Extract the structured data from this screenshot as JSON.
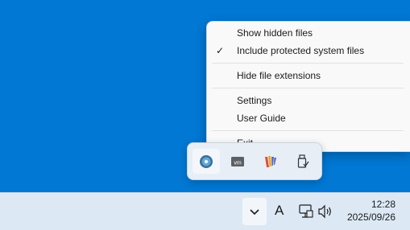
{
  "context_menu": {
    "items": [
      {
        "label": "Show hidden files",
        "checked": false
      },
      {
        "label": "Include protected system files",
        "checked": true
      },
      {
        "label": "Hide file extensions",
        "checked": false
      },
      {
        "label": "Settings",
        "checked": false
      },
      {
        "label": "User Guide",
        "checked": false
      },
      {
        "label": "Exit",
        "checked": false
      }
    ],
    "check_glyph": "✓"
  },
  "tray_flyout": {
    "icons": [
      "blue-disc-app-icon",
      "vmware-icon",
      "colored-stripes-app-icon",
      "usb-safely-remove-icon"
    ]
  },
  "taskbar": {
    "input_indicator": "A",
    "clock": {
      "time": "12:28",
      "date": "2025/09/26"
    }
  },
  "colors": {
    "desktop": "#0078d4",
    "menu_bg": "#f9f9f9",
    "taskbar_bg": "#dce9f5"
  }
}
